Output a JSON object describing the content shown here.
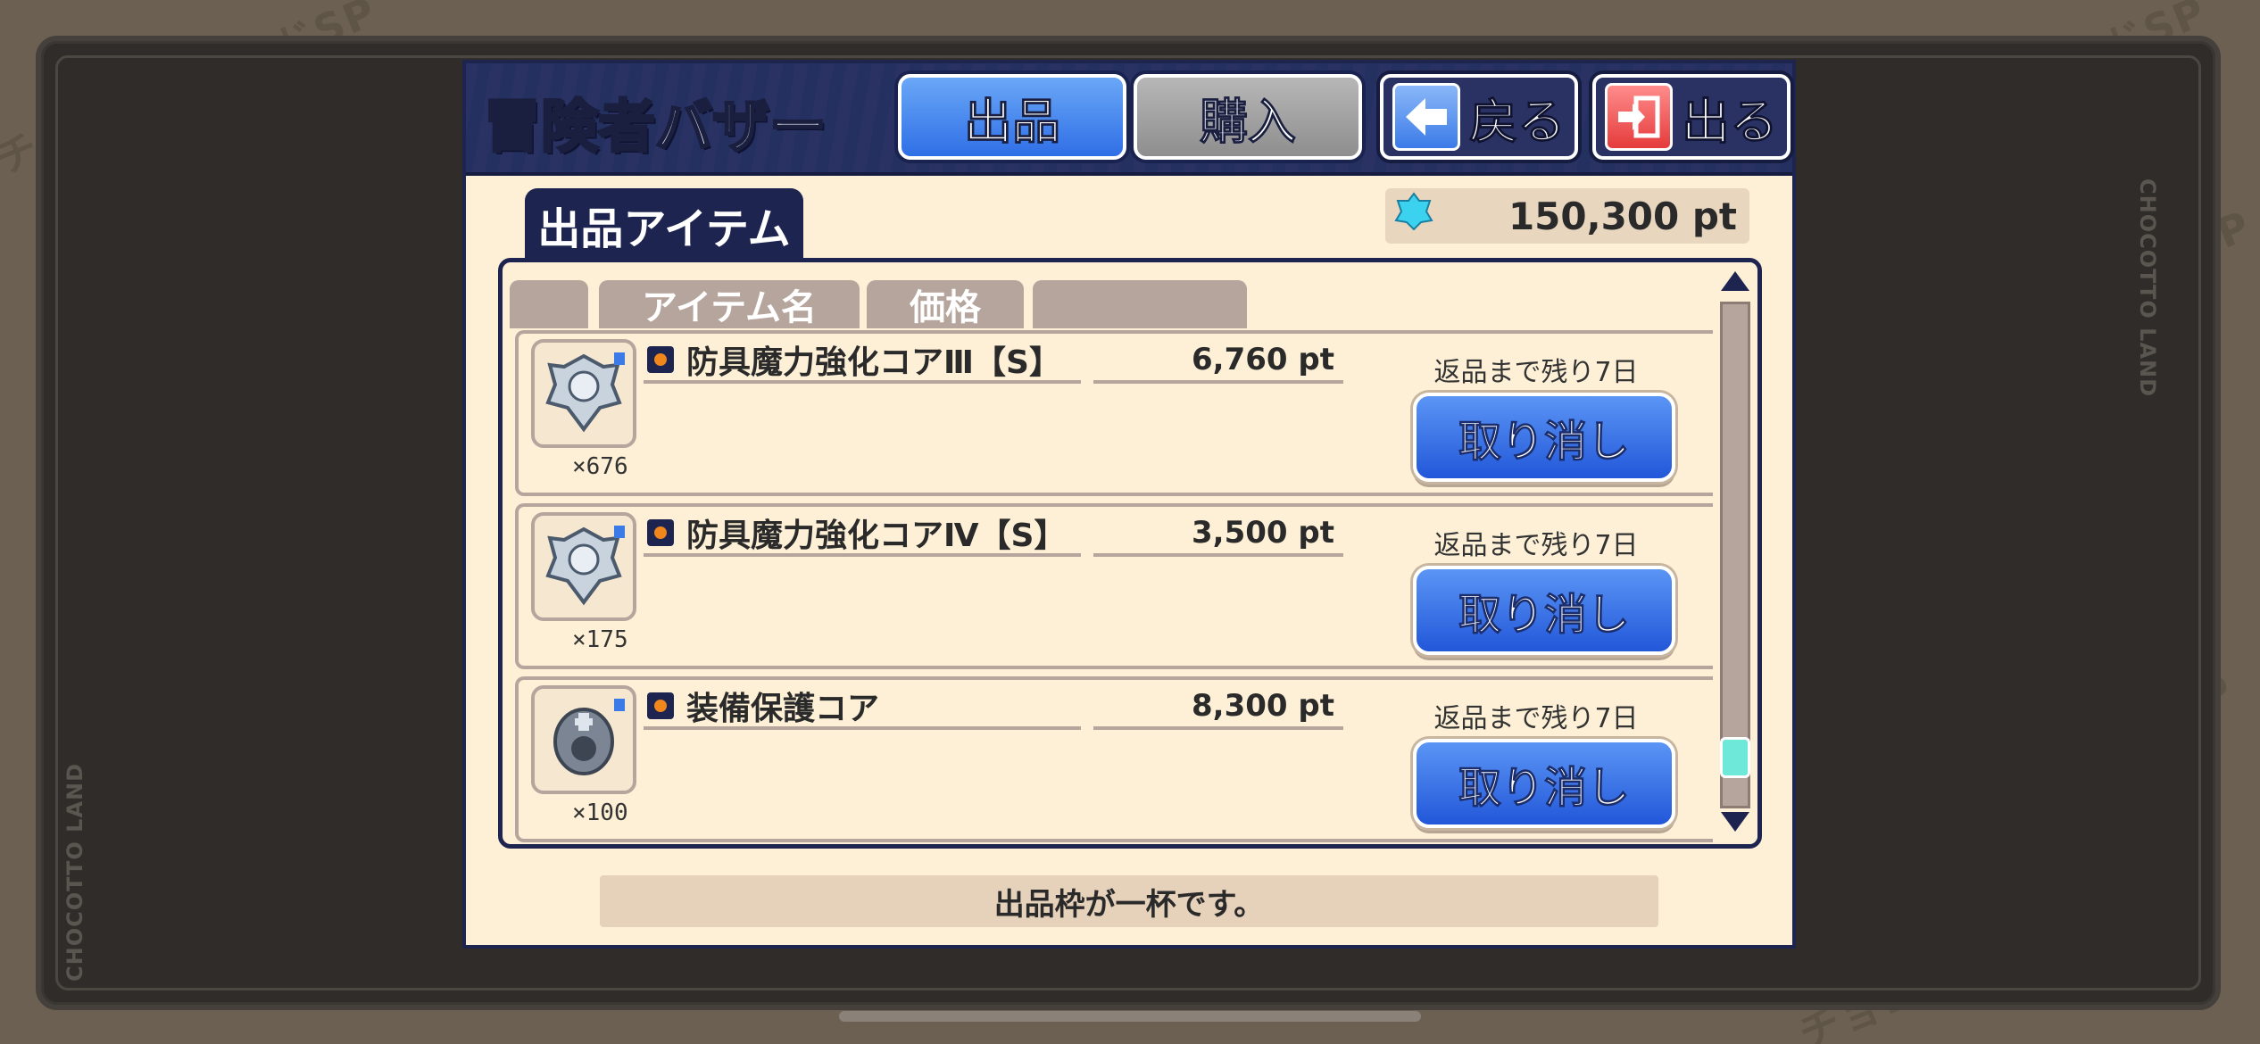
{
  "watermark": {
    "text": "チョコットランドSP",
    "side_text": "CHOCOTTO LAND"
  },
  "header": {
    "title": "冒険者バザー",
    "tabs": [
      {
        "label": "出品",
        "active": true
      },
      {
        "label": "購入",
        "active": false
      }
    ],
    "back_label": "戻る",
    "exit_label": "出る"
  },
  "section": {
    "tab_label": "出品アイテム",
    "points": "150,300 pt"
  },
  "table": {
    "columns": [
      "",
      "アイテム名",
      "価格",
      ""
    ],
    "rows": [
      {
        "name": "防具魔力強化コアⅢ【S】",
        "price": "6,760 pt",
        "qty": "×676",
        "remain": "返品まで残り7日",
        "action": "取り消し",
        "icon": "armor-core-iii-icon"
      },
      {
        "name": "防具魔力強化コアⅣ【S】",
        "price": "3,500 pt",
        "qty": "×175",
        "remain": "返品まで残り7日",
        "action": "取り消し",
        "icon": "armor-core-iv-icon"
      },
      {
        "name": "装備保護コア",
        "price": "8,300 pt",
        "qty": "×100",
        "remain": "返品まで残り7日",
        "action": "取り消し",
        "icon": "equipment-protect-core-icon"
      }
    ]
  },
  "footer": {
    "message": "出品枠が一杯です。"
  },
  "colors": {
    "navy": "#1d2450",
    "panel_bg": "#fdf0d6",
    "active_tab": "#2f6fe6",
    "cancel_button": "#2257d9",
    "scroll_thumb": "#6de8d9"
  }
}
